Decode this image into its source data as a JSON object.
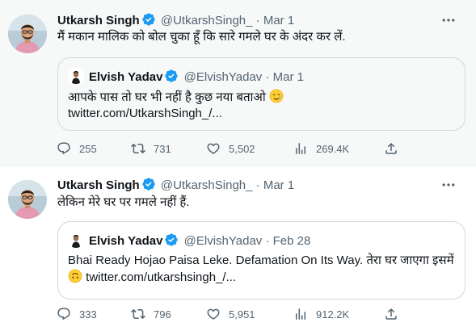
{
  "tweets": [
    {
      "author": {
        "name": "Utkarsh Singh",
        "handle": "@UtkarshSingh_",
        "verified": true
      },
      "separator": "·",
      "date": "Mar 1",
      "text": "मैं मकान मालिक को बोल चुका हूँ कि सारे गमले घर के अंदर कर लें.",
      "quote": {
        "author": {
          "name": "Elvish Yadav",
          "handle": "@ElvishYadav",
          "verified": true
        },
        "separator": "·",
        "date": "Mar 1",
        "text": "आपके पास तो घर भी नहीं है कुछ नया बताओ",
        "emoji": "face-with-tear-emoji",
        "link": "twitter.com/UtkarshSingh_/..."
      },
      "stats": {
        "replies": "255",
        "retweets": "731",
        "likes": "5,502",
        "views": "269.4K"
      }
    },
    {
      "author": {
        "name": "Utkarsh Singh",
        "handle": "@UtkarshSingh_",
        "verified": true
      },
      "separator": "·",
      "date": "Mar 1",
      "text": "लेकिन मेरे घर पर गमले नहीं हैं.",
      "quote": {
        "author": {
          "name": "Elvish Yadav",
          "handle": "@ElvishYadav",
          "verified": true
        },
        "separator": "·",
        "date": "Feb 28",
        "text": "Bhai Ready Hojao Paisa Leke. Defamation On Its Way. तेरा घर जाएगा इसमें",
        "emoji": "upside-down-face-emoji",
        "link": "twitter.com/utkarshsingh_/..."
      },
      "stats": {
        "replies": "333",
        "retweets": "796",
        "likes": "5,951",
        "views": "912.2K"
      }
    }
  ],
  "colors": {
    "verified_blue": "#1d9bf0",
    "secondary_text": "#536471",
    "border": "#cfd9de",
    "hover_background": "#f7f9f9"
  }
}
